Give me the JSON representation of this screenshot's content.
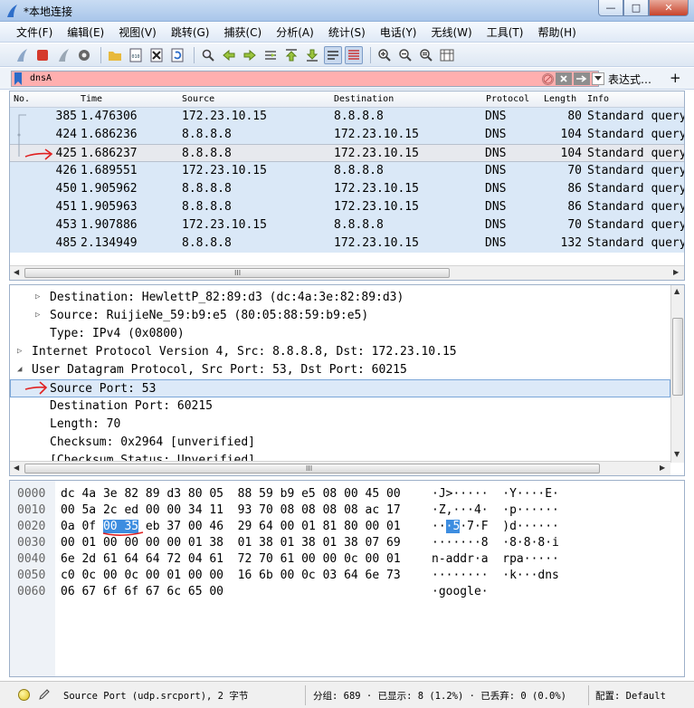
{
  "window": {
    "title": "*本地连接",
    "min": "—",
    "max": "□",
    "close": "✕"
  },
  "menu": [
    "文件(F)",
    "编辑(E)",
    "视图(V)",
    "跳转(G)",
    "捕获(C)",
    "分析(A)",
    "统计(S)",
    "电话(Y)",
    "无线(W)",
    "工具(T)",
    "帮助(H)"
  ],
  "filter": {
    "value": "dnsA",
    "expression_label": "表达式…",
    "plus": "+"
  },
  "packet_list": {
    "headers": {
      "no": "No.",
      "time": "Time",
      "source": "Source",
      "destination": "Destination",
      "protocol": "Protocol",
      "length": "Length",
      "info": "Info"
    },
    "rows": [
      {
        "no": "385",
        "time": "1.476306",
        "src": "172.23.10.15",
        "dst": "8.8.8.8",
        "proto": "DNS",
        "len": "80",
        "info": "Standard query"
      },
      {
        "no": "424",
        "time": "1.686236",
        "src": "8.8.8.8",
        "dst": "172.23.10.15",
        "proto": "DNS",
        "len": "104",
        "info": "Standard query"
      },
      {
        "no": "425",
        "time": "1.686237",
        "src": "8.8.8.8",
        "dst": "172.23.10.15",
        "proto": "DNS",
        "len": "104",
        "info": "Standard query"
      },
      {
        "no": "426",
        "time": "1.689551",
        "src": "172.23.10.15",
        "dst": "8.8.8.8",
        "proto": "DNS",
        "len": "70",
        "info": "Standard query"
      },
      {
        "no": "450",
        "time": "1.905962",
        "src": "8.8.8.8",
        "dst": "172.23.10.15",
        "proto": "DNS",
        "len": "86",
        "info": "Standard query"
      },
      {
        "no": "451",
        "time": "1.905963",
        "src": "8.8.8.8",
        "dst": "172.23.10.15",
        "proto": "DNS",
        "len": "86",
        "info": "Standard query"
      },
      {
        "no": "453",
        "time": "1.907886",
        "src": "172.23.10.15",
        "dst": "8.8.8.8",
        "proto": "DNS",
        "len": "70",
        "info": "Standard query"
      },
      {
        "no": "485",
        "time": "2.134949",
        "src": "8.8.8.8",
        "dst": "172.23.10.15",
        "proto": "DNS",
        "len": "132",
        "info": "Standard query"
      }
    ],
    "scroll_grip": "III"
  },
  "details": [
    {
      "tri": "▷",
      "indent": 1,
      "text": "Destination: HewlettP_82:89:d3 (dc:4a:3e:82:89:d3)"
    },
    {
      "tri": "▷",
      "indent": 1,
      "text": "Source: RuijieNe_59:b9:e5 (80:05:88:59:b9:e5)"
    },
    {
      "tri": "",
      "indent": 1,
      "text": "Type: IPv4 (0x0800)"
    },
    {
      "tri": "▷",
      "indent": 0,
      "text": "Internet Protocol Version 4, Src: 8.8.8.8, Dst: 172.23.10.15"
    },
    {
      "tri": "◢",
      "indent": 0,
      "text": "User Datagram Protocol, Src Port: 53, Dst Port: 60215"
    },
    {
      "tri": "",
      "indent": 1,
      "text": "Source Port: 53",
      "selected": true
    },
    {
      "tri": "",
      "indent": 1,
      "text": "Destination Port: 60215"
    },
    {
      "tri": "",
      "indent": 1,
      "text": "Length: 70"
    },
    {
      "tri": "",
      "indent": 1,
      "text": "Checksum: 0x2964 [unverified]"
    },
    {
      "tri": "",
      "indent": 1,
      "text": "[Checksum Status: Unverified]"
    }
  ],
  "bytes": [
    {
      "off": "0000",
      "hex_a": "dc 4a 3e 82 89 d3 80 05  88 59 b9 e5 08 00 45 00",
      "asc_a": "·J>·····  ·Y····E·"
    },
    {
      "off": "0010",
      "hex_a": "00 5a 2c ed 00 00 34 11  93 70 08 08 08 08 ac 17",
      "asc_a": "·Z,···4·  ·p······"
    },
    {
      "off": "0020",
      "hex_a": "0a 0f ",
      "hex_hl": "00 35",
      "hex_b": " eb 37 00 46  29 64 00 01 81 80 00 01",
      "asc_a": "··",
      "asc_hl": "·5",
      "asc_b": "·7·F  )d······"
    },
    {
      "off": "0030",
      "hex_a": "00 01 00 00 00 00 01 38  01 38 01 38 01 38 07 69",
      "asc_a": "·······8  ·8·8·8·i"
    },
    {
      "off": "0040",
      "hex_a": "6e 2d 61 64 64 72 04 61  72 70 61 00 00 0c 00 01",
      "asc_a": "n-addr·a  rpa·····"
    },
    {
      "off": "0050",
      "hex_a": "c0 0c 00 0c 00 01 00 00  16 6b 00 0c 03 64 6e 73",
      "asc_a": "········  ·k···dns"
    },
    {
      "off": "0060",
      "hex_a": "06 67 6f 6f 67 6c 65 00",
      "asc_a": "·google·"
    }
  ],
  "status": {
    "field": "Source Port (udp.srcport), 2 字节",
    "packets": "分组: 689 · 已显示: 8 (1.2%) · 已丢弃: 0 (0.0%)",
    "profile": "配置: Default"
  },
  "colors": {
    "row_bg": "#dae8f7",
    "filter_invalid": "#ffafaf",
    "hex_highlight": "#3d8de0",
    "annotation_red": "#e02020"
  }
}
